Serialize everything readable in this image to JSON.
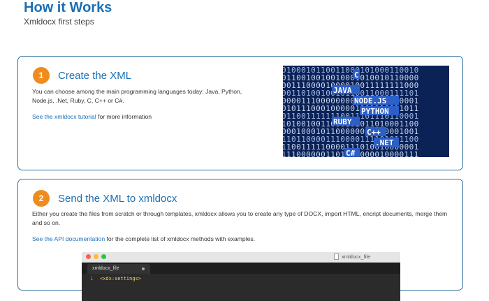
{
  "header": {
    "title": "How it Works",
    "subtitle": "Xmldocx first steps"
  },
  "step1": {
    "number": "1",
    "title": "Create the XML",
    "description": "You can choose among the main programming languages today: Java, Python, Node.js, .Net, Ruby, C, C++ or C#.",
    "link_text": "See the xmldocx tutorial",
    "after_link": " for more information",
    "image": {
      "background_color": "#0a2256",
      "languages": [
        "JAVA",
        "NODE.JS",
        "PYTHON",
        "RUBY",
        "C++",
        ".NET",
        "C#",
        "C"
      ]
    }
  },
  "step2": {
    "number": "2",
    "title": "Send the XML to xmldocx",
    "description": "Either you create the files from scratch or through templates, xmldocx allows you to create any type of DOCX, import HTML, encript documents, merge them and so on.",
    "link_text": "See the API documentation",
    "after_link": " for the complete list of xmldocx methods with examples.",
    "editor": {
      "window_title": "xmldocx_file",
      "tab_label": "xmldocx_file",
      "line_number": "1",
      "code_line": "<xdx:settings>"
    }
  },
  "colors": {
    "accent_blue": "#1b6fb5",
    "badge_orange": "#f08c1e",
    "card_border": "#2e6f9e"
  }
}
